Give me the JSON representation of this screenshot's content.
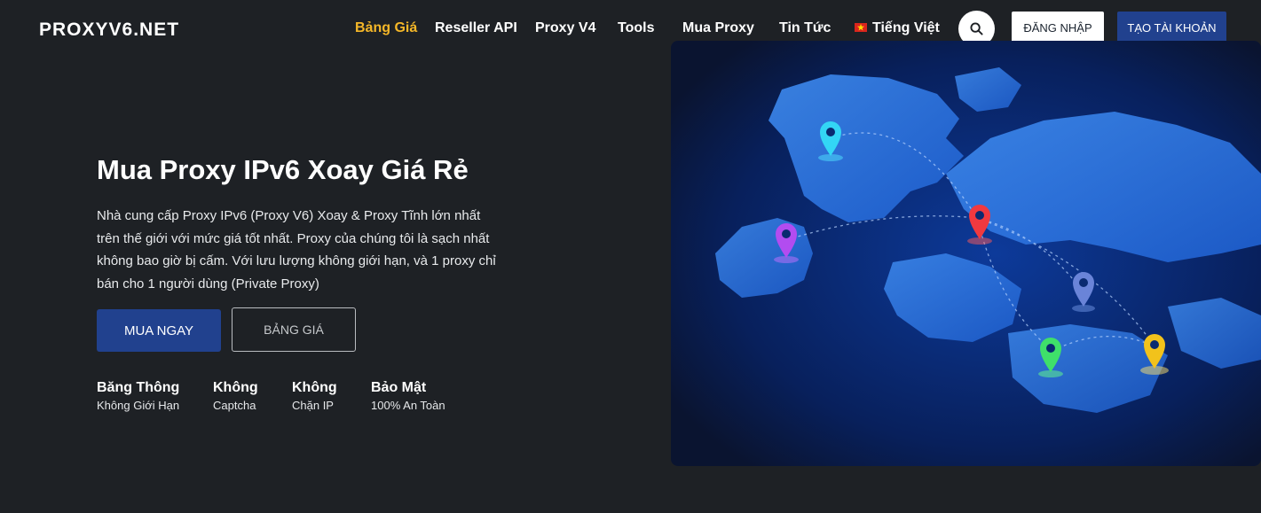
{
  "header": {
    "logo_text": "PROXYV6.NET",
    "nav": [
      {
        "label": "Bảng Giá",
        "active": true
      },
      {
        "label": "Reseller API"
      },
      {
        "label": "Proxy V4"
      },
      {
        "label": "Tools"
      },
      {
        "label": "Mua Proxy"
      },
      {
        "label": "Tin Tức"
      },
      {
        "label": "Tiếng Việt"
      }
    ],
    "login_label": "ĐĂNG NHẬP",
    "signup_label": "TẠO TÀI KHOẢN"
  },
  "hero": {
    "title": "Mua Proxy IPv6 Xoay Giá Rẻ",
    "description": "Nhà cung cấp Proxy IPv6 (Proxy V6) Xoay & Proxy Tĩnh lớn nhất trên thế giới với mức giá tốt nhất. Proxy của chúng tôi là sạch nhất không bao giờ bị cấm. Với lưu lượng không giới hạn, và 1 proxy chỉ bán cho 1 người dùng (Private Proxy)",
    "buy_label": "MUA NGAY",
    "pricing_label": "BẢNG GIÁ",
    "features": [
      {
        "title": "Băng Thông",
        "subtitle": "Không Giới Hạn"
      },
      {
        "title": "Không",
        "subtitle": "Captcha"
      },
      {
        "title": "Không",
        "subtitle": "Chặn IP"
      },
      {
        "title": "Bảo Mật",
        "subtitle": "100% An Toàn"
      }
    ]
  },
  "colors": {
    "background": "#1e2125",
    "accent_active": "#f5b728",
    "primary_button": "#21418e"
  },
  "icons": {
    "search": "search-icon",
    "language_flag": "vietnam-flag-icon",
    "map_pins": [
      "pin-cyan",
      "pin-purple",
      "pin-red",
      "pin-blue",
      "pin-green",
      "pin-yellow"
    ]
  }
}
